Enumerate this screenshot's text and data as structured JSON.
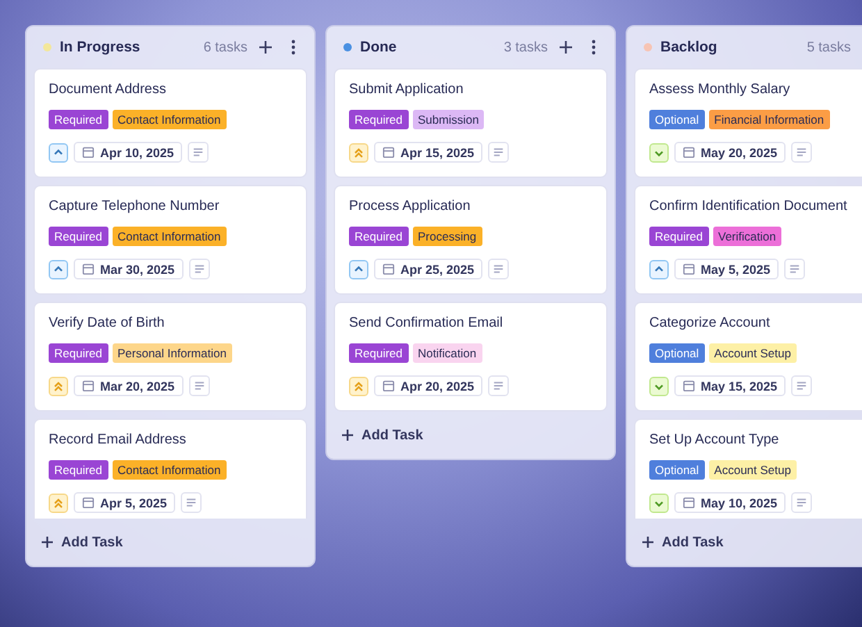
{
  "columns": [
    {
      "title": "In Progress",
      "color": "#f3e79a",
      "count": "6 tasks",
      "clipped": false,
      "cards": [
        {
          "title": "Document Address",
          "tags": [
            {
              "label": "Required",
              "color": "#9a45d4"
            },
            {
              "label": "Contact Information",
              "color": "#fbb128"
            }
          ],
          "priority": {
            "kind": "high"
          },
          "date": "Apr 10, 2025"
        },
        {
          "title": "Capture Telephone Number",
          "tags": [
            {
              "label": "Required",
              "color": "#9a45d4"
            },
            {
              "label": "Contact Information",
              "color": "#fbb128"
            }
          ],
          "priority": {
            "kind": "high"
          },
          "date": "Mar 30, 2025"
        },
        {
          "title": "Verify Date of Birth",
          "tags": [
            {
              "label": "Required",
              "color": "#9a45d4"
            },
            {
              "label": "Personal Information",
              "color": "#fdd68a"
            }
          ],
          "priority": {
            "kind": "urgent"
          },
          "date": "Mar 20, 2025"
        },
        {
          "title": "Record Email Address",
          "tags": [
            {
              "label": "Required",
              "color": "#9a45d4"
            },
            {
              "label": "Contact Information",
              "color": "#fbb128"
            }
          ],
          "priority": {
            "kind": "urgent"
          },
          "date": "Apr 5, 2025"
        }
      ],
      "add_label": "Add Task"
    },
    {
      "title": "Done",
      "color": "#4a90e2",
      "count": "3 tasks",
      "clipped": false,
      "cards": [
        {
          "title": "Submit Application",
          "tags": [
            {
              "label": "Required",
              "color": "#9a45d4"
            },
            {
              "label": "Submission",
              "color": "#dcb8f5"
            }
          ],
          "priority": {
            "kind": "urgent"
          },
          "date": "Apr 15, 2025"
        },
        {
          "title": "Process Application",
          "tags": [
            {
              "label": "Required",
              "color": "#9a45d4"
            },
            {
              "label": "Processing",
              "color": "#fbb128"
            }
          ],
          "priority": {
            "kind": "high"
          },
          "date": "Apr 25, 2025"
        },
        {
          "title": "Send Confirmation Email",
          "tags": [
            {
              "label": "Required",
              "color": "#9a45d4"
            },
            {
              "label": "Notification",
              "color": "#f9d4ef"
            }
          ],
          "priority": {
            "kind": "urgent"
          },
          "date": "Apr 20, 2025"
        }
      ],
      "add_label": "Add Task"
    },
    {
      "title": "Backlog",
      "color": "#f7c4b4",
      "count": "5 tasks",
      "clipped": true,
      "cards": [
        {
          "title": "Assess Monthly Salary",
          "tags": [
            {
              "label": "Optional",
              "color": "#4f7fdc"
            },
            {
              "label": "Financial Information",
              "color": "#fb9d45"
            }
          ],
          "priority": {
            "kind": "low"
          },
          "date": "May 20, 2025"
        },
        {
          "title": "Confirm Identification Document",
          "tags": [
            {
              "label": "Required",
              "color": "#9a45d4"
            },
            {
              "label": "Verification",
              "color": "#ec6fd8"
            }
          ],
          "priority": {
            "kind": "high"
          },
          "date": "May 5, 2025"
        },
        {
          "title": "Categorize Account",
          "tags": [
            {
              "label": "Optional",
              "color": "#4f7fdc"
            },
            {
              "label": "Account Setup",
              "color": "#fdf0a6"
            }
          ],
          "priority": {
            "kind": "low"
          },
          "date": "May 15, 2025"
        },
        {
          "title": "Set Up Account Type",
          "tags": [
            {
              "label": "Optional",
              "color": "#4f7fdc"
            },
            {
              "label": "Account Setup",
              "color": "#fdf0a6"
            }
          ],
          "priority": {
            "kind": "low"
          },
          "date": "May 10, 2025"
        }
      ],
      "add_label": "Add Task"
    }
  ]
}
